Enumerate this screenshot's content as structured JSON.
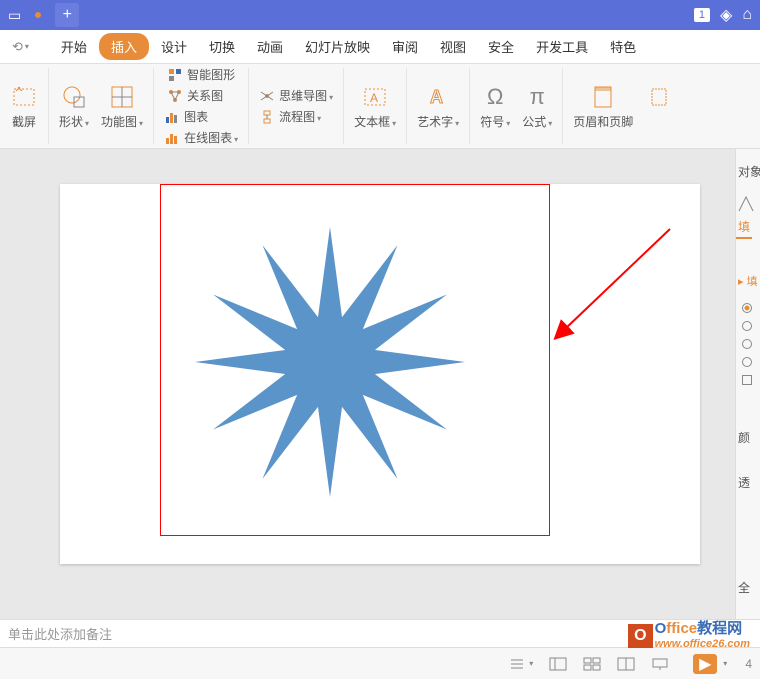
{
  "titlebar": {
    "badge": "1"
  },
  "menu": {
    "undo": "⟲",
    "items": [
      "开始",
      "插入",
      "设计",
      "切换",
      "动画",
      "幻灯片放映",
      "审阅",
      "视图",
      "安全",
      "开发工具",
      "特色"
    ],
    "active_index": 1
  },
  "ribbon": {
    "screenshot": "截屏",
    "shapes": "形状",
    "function_graph": "功能图",
    "smart_art": "智能图形",
    "relation": "关系图",
    "chart": "图表",
    "online_chart": "在线图表",
    "mindmap": "思维导图",
    "flowchart": "流程图",
    "textbox": "文本框",
    "wordart": "艺术字",
    "symbol": "符号",
    "formula": "公式",
    "header_footer": "页眉和页脚"
  },
  "side": {
    "object": "对象",
    "fill": "填",
    "section": "▸ 填",
    "color": "颜",
    "transparency": "透",
    "all": "全"
  },
  "notes": {
    "placeholder": "单击此处添加备注"
  },
  "status": {
    "page": "4"
  },
  "watermark": {
    "brand": "Office教程网",
    "url": "www.office26.com",
    "o": "O"
  }
}
